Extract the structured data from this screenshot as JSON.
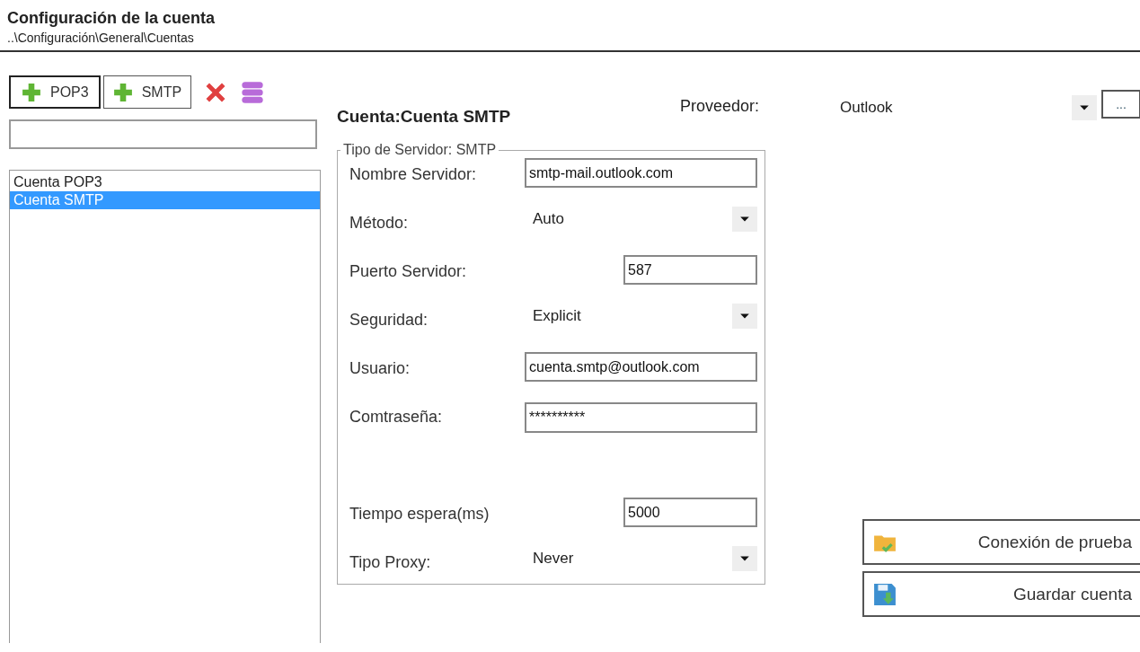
{
  "header": {
    "title": "Configuración de la cuenta",
    "breadcrumb": "..\\Configuración\\General\\Cuentas"
  },
  "toolbar": [
    {
      "kind": "add",
      "label": "POP3"
    },
    {
      "kind": "add",
      "label": "SMTP"
    },
    {
      "kind": "delete"
    },
    {
      "kind": "stack"
    }
  ],
  "accounts": [
    {
      "name": "Cuenta POP3",
      "selected": false
    },
    {
      "name": "Cuenta SMTP",
      "selected": true
    }
  ],
  "account_heading": "Cuenta:Cuenta SMTP",
  "provider": {
    "label": "Proveedor:",
    "value": "Outlook",
    "more_button": "..."
  },
  "server_group": {
    "legend": "Tipo de Servidor: SMTP",
    "fields": [
      {
        "kind": "text",
        "label": "Nombre Servidor:",
        "value": "smtp-mail.outlook.com"
      },
      {
        "kind": "select",
        "label": "Método:",
        "value": "Auto"
      },
      {
        "kind": "short",
        "label": "Puerto Servidor:",
        "value": "587"
      },
      {
        "kind": "select",
        "label": "Seguridad:",
        "value": "Explicit"
      },
      {
        "kind": "text",
        "label": "Usuario:",
        "value": "cuenta.smtp@outlook.com"
      },
      {
        "kind": "password",
        "label": "Comtraseña:",
        "value": "**********"
      },
      {
        "kind": "spacer"
      },
      {
        "kind": "short",
        "label": "Tiempo espera(ms)",
        "value": "5000"
      },
      {
        "kind": "select",
        "label": "Tipo Proxy:",
        "value": "Never"
      }
    ]
  },
  "actions": [
    {
      "kind": "test",
      "label": "Conexión de prueba"
    },
    {
      "kind": "save",
      "label": "Guardar cuenta"
    }
  ]
}
